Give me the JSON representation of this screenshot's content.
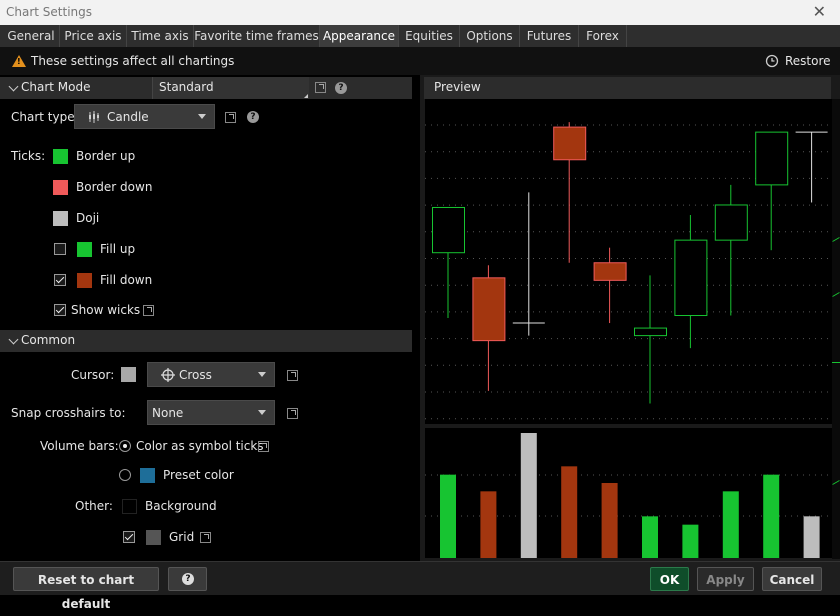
{
  "window": {
    "title": "Chart Settings"
  },
  "tabs": [
    "General",
    "Price axis",
    "Time axis",
    "Favorite time frames",
    "Appearance",
    "Equities",
    "Options",
    "Futures",
    "Forex"
  ],
  "active_tab": "Appearance",
  "banner": {
    "text": "These settings affect all chartings",
    "restore_label": "Restore"
  },
  "chart_mode": {
    "section_label": "Chart Mode",
    "value": "Standard"
  },
  "chart_type": {
    "label": "Chart type:",
    "value": "Candle"
  },
  "ticks": {
    "label": "Ticks:",
    "border_up": "Border up",
    "border_down": "Border down",
    "doji": "Doji",
    "fill_up": "Fill up",
    "fill_down": "Fill down",
    "show_wicks": "Show wicks"
  },
  "colors": {
    "up": "#17c431",
    "down_border": "#f05a5a",
    "doji": "#bdbdbd",
    "fill_down": "#a3360f",
    "cursor": "#a8a8a8",
    "preset": "#1e6e99",
    "background": "#000000",
    "grid": "#555555",
    "ok_button": "#0f4d2a"
  },
  "common": {
    "section_label": "Common",
    "cursor_label": "Cursor:",
    "cursor_value": "Cross",
    "snap_label": "Snap crosshairs to:",
    "snap_value": "None",
    "volume_label": "Volume bars:",
    "volume_option1": "Color as symbol ticks",
    "volume_option2": "Preset color",
    "other_label": "Other:",
    "background_label": "Background",
    "grid_label": "Grid"
  },
  "preview": {
    "label": "Preview"
  },
  "buttons": {
    "reset": "Reset to chart default",
    "help": "?",
    "ok": "OK",
    "apply": "Apply",
    "cancel": "Cancel"
  },
  "chart_data": {
    "type": "candlestick",
    "candles": [
      {
        "open": 4.8,
        "high": 5.8,
        "low": 2.2,
        "close": 6.6,
        "style": "up-hollow"
      },
      {
        "open": 3.8,
        "high": 4.3,
        "low": -0.7,
        "close": 1.3,
        "style": "down-filled"
      },
      {
        "open": 2.0,
        "high": 7.2,
        "low": 1.5,
        "close": 2.0,
        "style": "doji"
      },
      {
        "open": 8.5,
        "high": 10.0,
        "low": 4.4,
        "close": 9.8,
        "style": "down-filled"
      },
      {
        "open": 4.4,
        "high": 5.0,
        "low": 2.0,
        "close": 3.7,
        "style": "down-filled"
      },
      {
        "open": 1.5,
        "high": 3.9,
        "low": -1.2,
        "close": 1.8,
        "style": "up-hollow"
      },
      {
        "open": 2.3,
        "high": 6.3,
        "low": 1.0,
        "close": 5.3,
        "style": "up-hollow"
      },
      {
        "open": 5.3,
        "high": 7.5,
        "low": 2.3,
        "close": 6.7,
        "style": "up-hollow"
      },
      {
        "open": 7.5,
        "high": 9.6,
        "low": 4.9,
        "close": 9.6,
        "style": "up-hollow"
      },
      {
        "open": 9.6,
        "high": 9.6,
        "low": 6.8,
        "close": 9.6,
        "style": "doji"
      }
    ],
    "volume": [
      {
        "value": 100,
        "style": "up"
      },
      {
        "value": 80,
        "style": "down"
      },
      {
        "value": 150,
        "style": "doji"
      },
      {
        "value": 110,
        "style": "down"
      },
      {
        "value": 90,
        "style": "down"
      },
      {
        "value": 50,
        "style": "up"
      },
      {
        "value": 40,
        "style": "up"
      },
      {
        "value": 80,
        "style": "up"
      },
      {
        "value": 100,
        "style": "up"
      },
      {
        "value": 50,
        "style": "doji"
      }
    ]
  }
}
